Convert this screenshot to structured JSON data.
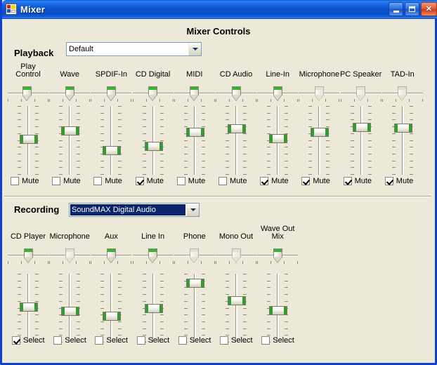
{
  "window": {
    "title": "Mixer",
    "icon": "mixer-icon",
    "buttons": {
      "minimize": "_",
      "maximize": "□",
      "close": "✕"
    }
  },
  "header": {
    "title": "Mixer Controls"
  },
  "playback": {
    "label": "Playback",
    "device": "Default",
    "mute_label": "Mute",
    "channels": [
      {
        "name": "Play Control",
        "lines": [
          "Play",
          "Control"
        ],
        "balance": 46,
        "balance_enabled": true,
        "volume": 52,
        "mute": false
      },
      {
        "name": "Wave",
        "lines": [
          "Wave"
        ],
        "balance": 50,
        "balance_enabled": true,
        "volume": 66,
        "mute": false
      },
      {
        "name": "SPDIF-In",
        "lines": [
          "SPDIF-In"
        ],
        "balance": 50,
        "balance_enabled": true,
        "volume": 33,
        "mute": false
      },
      {
        "name": "CD Digital",
        "lines": [
          "CD Digital"
        ],
        "balance": 50,
        "balance_enabled": true,
        "volume": 40,
        "mute": true
      },
      {
        "name": "MIDI",
        "lines": [
          "MIDI"
        ],
        "balance": 50,
        "balance_enabled": true,
        "volume": 64,
        "mute": false
      },
      {
        "name": "CD Audio",
        "lines": [
          "CD Audio"
        ],
        "balance": 50,
        "balance_enabled": true,
        "volume": 70,
        "mute": false
      },
      {
        "name": "Line-In",
        "lines": [
          "Line-In"
        ],
        "balance": 50,
        "balance_enabled": true,
        "volume": 53,
        "mute": true
      },
      {
        "name": "Microphone",
        "lines": [
          "Microphone"
        ],
        "balance": 50,
        "balance_enabled": false,
        "volume": 63,
        "mute": true
      },
      {
        "name": "PC Speaker",
        "lines": [
          "PC Speaker"
        ],
        "balance": 50,
        "balance_enabled": false,
        "volume": 72,
        "mute": true
      },
      {
        "name": "TAD-In",
        "lines": [
          "TAD-In"
        ],
        "balance": 50,
        "balance_enabled": false,
        "volume": 71,
        "mute": true
      }
    ]
  },
  "recording": {
    "label": "Recording",
    "device": "SoundMAX Digital Audio",
    "device_selected": true,
    "select_label": "Select",
    "channels": [
      {
        "name": "CD Player",
        "lines": [
          "CD Player"
        ],
        "balance": 50,
        "balance_enabled": true,
        "volume": 52,
        "select": true
      },
      {
        "name": "Microphone",
        "lines": [
          "Microphone"
        ],
        "balance": 50,
        "balance_enabled": false,
        "volume": 45,
        "select": false
      },
      {
        "name": "Aux",
        "lines": [
          "Aux"
        ],
        "balance": 50,
        "balance_enabled": true,
        "volume": 36,
        "select": false
      },
      {
        "name": "Line In",
        "lines": [
          "Line In"
        ],
        "balance": 50,
        "balance_enabled": true,
        "volume": 50,
        "select": false
      },
      {
        "name": "Phone",
        "lines": [
          "Phone"
        ],
        "balance": 50,
        "balance_enabled": false,
        "volume": 92,
        "select": false
      },
      {
        "name": "Mono Out",
        "lines": [
          "Mono Out"
        ],
        "balance": 50,
        "balance_enabled": false,
        "volume": 62,
        "select": false
      },
      {
        "name": "Wave Out Mix",
        "lines": [
          "Wave Out",
          "Mix"
        ],
        "balance": 50,
        "balance_enabled": true,
        "volume": 46,
        "select": false
      }
    ]
  },
  "colors": {
    "titlebar": "#0a4fc9",
    "face": "#ece9d8",
    "accent_green": "#34b334",
    "select_blue": "#0a246a"
  }
}
